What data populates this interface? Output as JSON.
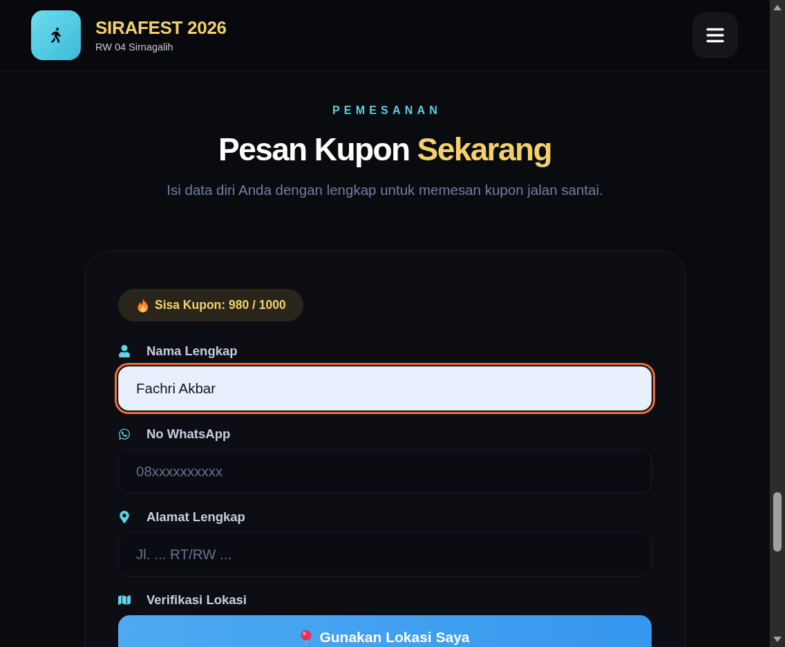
{
  "header": {
    "title": "SIRAFEST 2026",
    "subtitle": "RW 04 Sirnagalih"
  },
  "section": {
    "eyebrow": "PEMESANAN",
    "title": "Pesan Kupon",
    "title_highlight": "Sekarang",
    "subtitle": "Isi data diri Anda dengan lengkap untuk memesan kupon jalan santai."
  },
  "form": {
    "quota_badge": "Sisa Kupon: 980 / 1000",
    "fields": [
      {
        "kind": "input",
        "label": "Nama Lengkap",
        "value": "Fachri Akbar",
        "focused": true
      },
      {
        "kind": "input",
        "label": "No WhatsApp",
        "placeholder": "08xxxxxxxxxx",
        "focused": false
      },
      {
        "kind": "input",
        "label": "Alamat Lengkap",
        "placeholder": "Jl. ... RT/RW ...",
        "focused": false
      },
      {
        "kind": "button",
        "label": "Verifikasi Lokasi",
        "button": "Gunakan Lokasi Saya"
      }
    ]
  }
}
